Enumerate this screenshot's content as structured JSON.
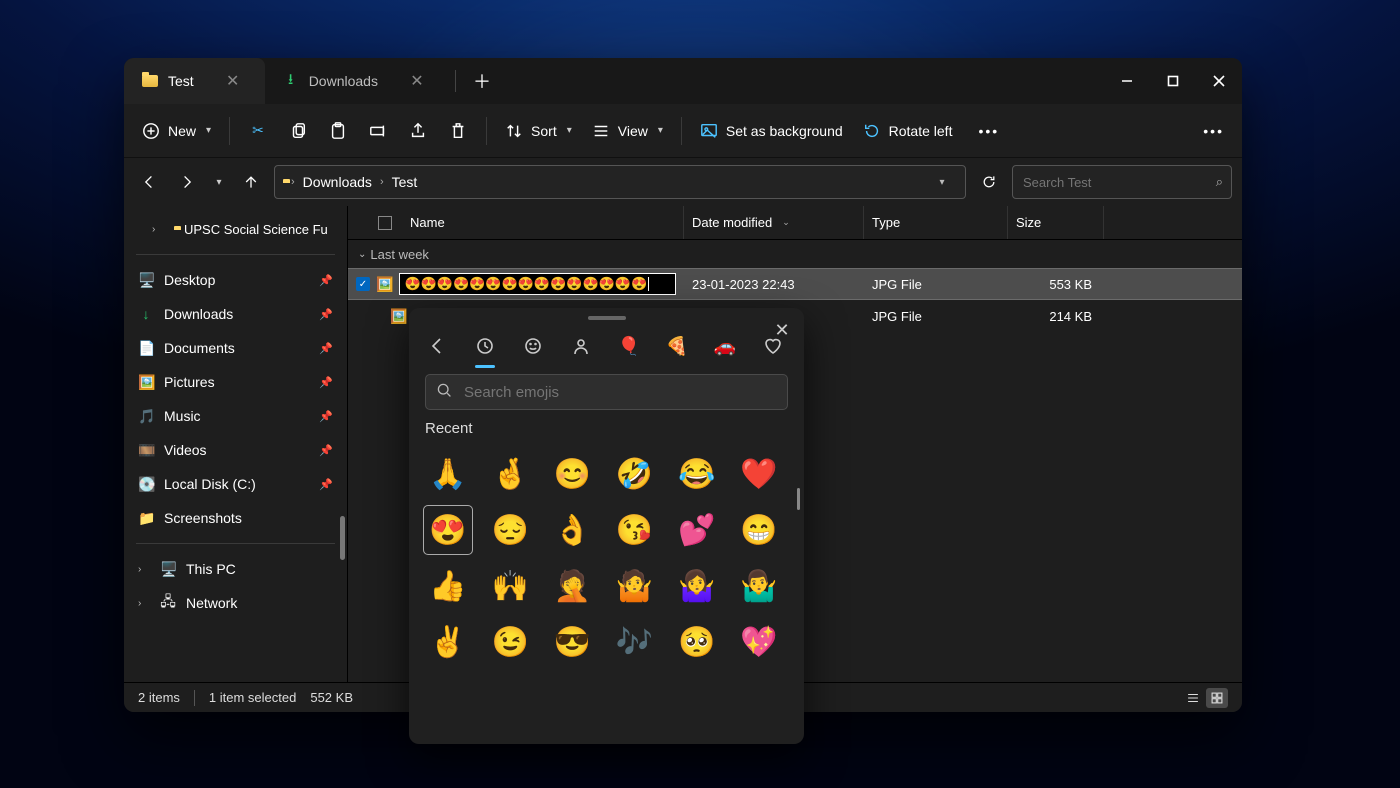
{
  "tabs": [
    {
      "label": "Test",
      "active": true
    },
    {
      "label": "Downloads",
      "active": false
    }
  ],
  "toolbar": {
    "new": "New",
    "sort": "Sort",
    "view": "View",
    "set_bg": "Set as background",
    "rotate": "Rotate left"
  },
  "breadcrumb": [
    "Downloads",
    "Test"
  ],
  "search": {
    "placeholder": "Search Test"
  },
  "sidebar": {
    "tree_item": "UPSC Social Science Fu",
    "quick": [
      {
        "label": "Desktop",
        "icon": "🖥️",
        "color": "#2b88d8"
      },
      {
        "label": "Downloads",
        "icon": "↓",
        "color": "#27c06a"
      },
      {
        "label": "Documents",
        "icon": "📄",
        "color": "#8ab4f8"
      },
      {
        "label": "Pictures",
        "icon": "🖼️",
        "color": "#3aa0ff"
      },
      {
        "label": "Music",
        "icon": "🎵",
        "color": "#f06292"
      },
      {
        "label": "Videos",
        "icon": "🎞️",
        "color": "#7e57c2"
      },
      {
        "label": "Local Disk (C:)",
        "icon": "💽",
        "color": "#90a4ae"
      },
      {
        "label": "Screenshots",
        "icon": "📁",
        "color": "#ffca5f"
      }
    ],
    "locations": [
      {
        "label": "This PC",
        "icon": "🖥️"
      },
      {
        "label": "Network",
        "icon": "🖧"
      }
    ]
  },
  "columns": {
    "name": "Name",
    "date": "Date modified",
    "type": "Type",
    "size": "Size"
  },
  "group": "Last week",
  "rows": [
    {
      "selected": true,
      "editing": true,
      "name": "😍😍😍😍😍😍😍😍😍😍😍😍😍😍😍",
      "date": "23-01-2023 22:43",
      "type": "JPG File",
      "size": "553 KB"
    },
    {
      "selected": false,
      "editing": false,
      "name": "",
      "date": "",
      "type": "JPG File",
      "size": "214 KB"
    }
  ],
  "status": {
    "items": "2 items",
    "selected": "1 item selected",
    "size": "552 KB"
  },
  "emoji": {
    "search_placeholder": "Search emojis",
    "section": "Recent",
    "grid": [
      "🙏",
      "🤞",
      "😊",
      "🤣",
      "😂",
      "❤️",
      "😍",
      "😔",
      "👌",
      "😘",
      "💕",
      "😁",
      "👍",
      "🙌",
      "🤦",
      "🤷",
      "🤷‍♀️",
      "🤷‍♂️",
      "✌️",
      "😉",
      "😎",
      "🎶",
      "🥺",
      "💖"
    ],
    "selected_index": 6
  }
}
